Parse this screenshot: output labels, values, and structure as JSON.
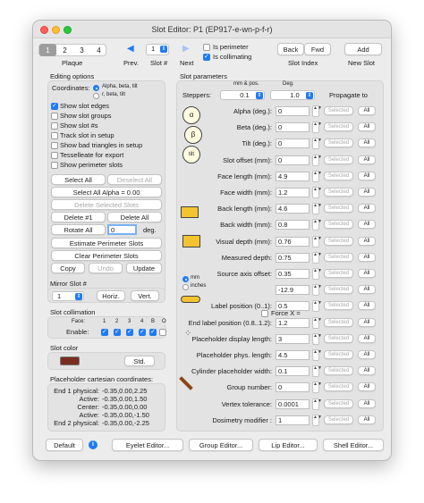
{
  "window": {
    "title": "Slot Editor: P1 (EP917-e-wn-p-f-r)"
  },
  "toolbar": {
    "plaque_tabs": [
      "1",
      "2",
      "3",
      "4"
    ],
    "plaque_label": "Plaque",
    "prev_label": "Prev.",
    "slot_label": "Slot #",
    "slot_value": "1",
    "next_label": "Next",
    "is_perimeter": "Is perimeter",
    "is_collimating": "Is collimating",
    "back": "Back",
    "fwd": "Fwd",
    "slot_index": "Slot Index",
    "add": "Add",
    "new_slot": "New Slot"
  },
  "editing": {
    "title": "Editing options",
    "coordinates_label": "Coordinates:",
    "coord_opt1": "Alpha, beta, tilt",
    "coord_opt2": "r, beta, tilt",
    "checks": [
      "Show slot edges",
      "Show slot groups",
      "Show slot #s",
      "Track slot in setup",
      "Show bad triangles in setup",
      "Tesselleate for export",
      "Show perimeter slots"
    ],
    "select_all": "Select All",
    "deselect_all": "Deselect All",
    "select_all_alpha": "Select All Alpha = 0.00",
    "delete_selected": "Delete Selected Slots",
    "delete_1": "Delete #1",
    "delete_all": "Delete All",
    "rotate_all": "Rotate All",
    "rotate_value": "0",
    "deg": "deg.",
    "estimate": "Estimate Perimeter Slots",
    "clear": "Clear Perimeter Slots",
    "copy": "Copy",
    "undo": "Undo",
    "update": "Update"
  },
  "mirror": {
    "title": "Mirror Slot #",
    "value": "1",
    "horiz": "Horiz.",
    "vert": "Vert."
  },
  "collimation": {
    "title": "Slot collimation",
    "face_label": "Face:",
    "enable_label": "Enable:",
    "faces": [
      "1",
      "2",
      "3",
      "4",
      "B",
      "O"
    ]
  },
  "color": {
    "title": "Slot color",
    "swatch": "#7a2d1e",
    "std": "Std."
  },
  "cartesian": {
    "title": "Placeholder cartesian coordinates:",
    "rows": [
      {
        "label": "End 1 physical:",
        "value": "-0.35,0.00,2.25"
      },
      {
        "label": "Active:",
        "value": "-0.35,0.00,1.50"
      },
      {
        "label": "Center:",
        "value": "-0.35,0.00,0.00"
      },
      {
        "label": "Active:",
        "value": "-0.35,0.00,-1.50"
      },
      {
        "label": "End 2 physical:",
        "value": "-0.35,0.00,-2.25"
      }
    ]
  },
  "params": {
    "title": "Slot parameters",
    "mm_pos": "mm & pos.",
    "deg": "Deg.",
    "steppers_label": "Steppers:",
    "stepper_mm": "0.1",
    "stepper_deg": "1.0",
    "propagate": "Propagate to",
    "selected": "Selected",
    "all": "All",
    "unit_mm": "mm",
    "unit_inches": "inches",
    "force_x": "Force X =",
    "rows": [
      {
        "label": "Alpha (deg.):",
        "value": "0"
      },
      {
        "label": "Beta (deg.):",
        "value": "0"
      },
      {
        "label": "Tilt (deg.):",
        "value": "0"
      },
      {
        "label": "Slot offset (mm):",
        "value": "0"
      },
      {
        "label": "Face length (mm):",
        "value": "4.9"
      },
      {
        "label": "Face width (mm):",
        "value": "1.2"
      },
      {
        "label": "Back length (mm):",
        "value": "4.6"
      },
      {
        "label": "Back width (mm):",
        "value": "0.8"
      },
      {
        "label": "Visual depth (mm):",
        "value": "0.76"
      },
      {
        "label": "Measured depth:",
        "value": "0.75"
      },
      {
        "label": "Source axis offset:",
        "value": "0.35"
      },
      {
        "label": "",
        "value": "-12.9"
      },
      {
        "label": "Label position (0..1):",
        "value": "0.5"
      },
      {
        "label": "End label position (0.8..1.2):",
        "value": "1.2"
      },
      {
        "label": "Placeholder display length:",
        "value": "3"
      },
      {
        "label": "Placeholder phys. length:",
        "value": "4.5"
      },
      {
        "label": "Cylinder placeholder width:",
        "value": "0.1"
      },
      {
        "label": "Group number:",
        "value": "0"
      },
      {
        "label": "Vertex tolerance:",
        "value": "0.0001"
      },
      {
        "label": "Dosimetry  modifier :",
        "value": "1"
      }
    ]
  },
  "bottom": {
    "default": "Default",
    "eyelet": "Eyelet Editor...",
    "group": "Group Editor...",
    "lip": "Lip Editor...",
    "shell": "Shell Editor..."
  }
}
